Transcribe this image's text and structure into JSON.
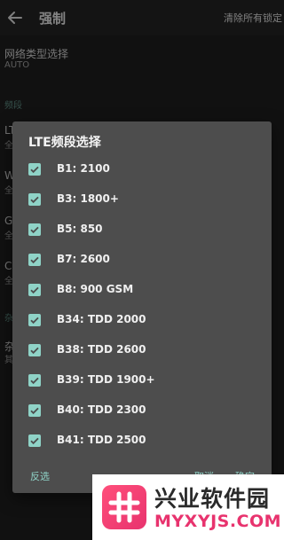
{
  "topbar": {
    "title": "强制",
    "clear_label": "清除所有锁定"
  },
  "background": {
    "network_type_title": "网络类型选择",
    "network_type_value": "AUTO",
    "band_section": "频段",
    "partial_rows": [
      {
        "label": "LT",
        "sub": "全"
      },
      {
        "label": "W",
        "sub": "全"
      },
      {
        "label": "G",
        "sub": "全"
      },
      {
        "label": "C",
        "sub": "全"
      }
    ],
    "section2": "杂",
    "row5": {
      "label": "杂",
      "sub": "其"
    }
  },
  "dialog": {
    "title": "LTE频段选择",
    "options": [
      {
        "label": "B1: 2100",
        "checked": true
      },
      {
        "label": "B3: 1800+",
        "checked": true
      },
      {
        "label": "B5: 850",
        "checked": true
      },
      {
        "label": "B7: 2600",
        "checked": true
      },
      {
        "label": "B8: 900 GSM",
        "checked": true
      },
      {
        "label": "B34: TDD 2000",
        "checked": true
      },
      {
        "label": "B38: TDD 2600",
        "checked": true
      },
      {
        "label": "B39: TDD 1900+",
        "checked": true
      },
      {
        "label": "B40: TDD 2300",
        "checked": true
      },
      {
        "label": "B41: TDD 2500",
        "checked": true
      }
    ],
    "invert_label": "反选",
    "cancel_label": "取消",
    "ok_label": "确定"
  },
  "watermark": {
    "name": "兴业软件园",
    "url": "MYXYJS.COM"
  },
  "colors": {
    "accent": "#8fd3c7",
    "dialog_bg": "#4d4d4d",
    "page_bg": "#202020"
  }
}
